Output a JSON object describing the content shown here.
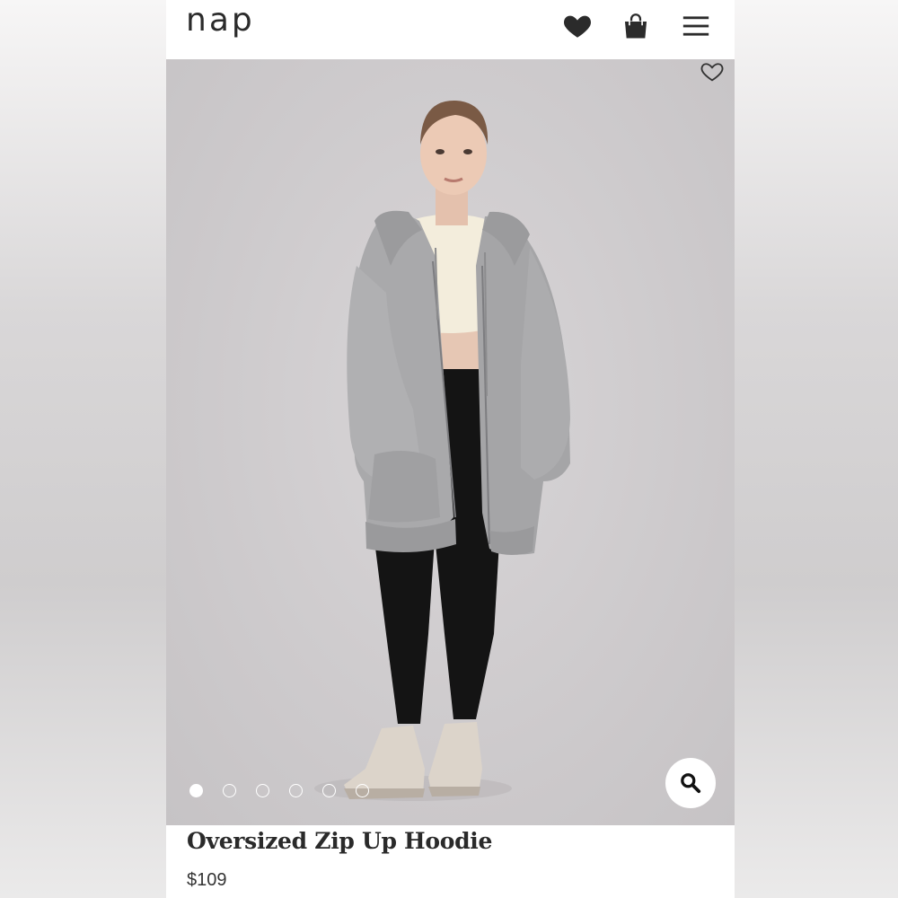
{
  "brand": {
    "logo": "nap"
  },
  "header": {
    "icons": [
      "heart-icon",
      "shopping-bag-icon",
      "hamburger-menu-icon"
    ]
  },
  "product": {
    "title": "Oversized Zip Up Hoodie",
    "price": "$109",
    "image_alt": "Model wearing grey oversized zip up hoodie",
    "carousel": {
      "total": 6,
      "active": 1
    }
  },
  "colors": {
    "hoodie": "#a9a9ab",
    "background": "#cdcacc",
    "text": "#2a2a2a"
  }
}
